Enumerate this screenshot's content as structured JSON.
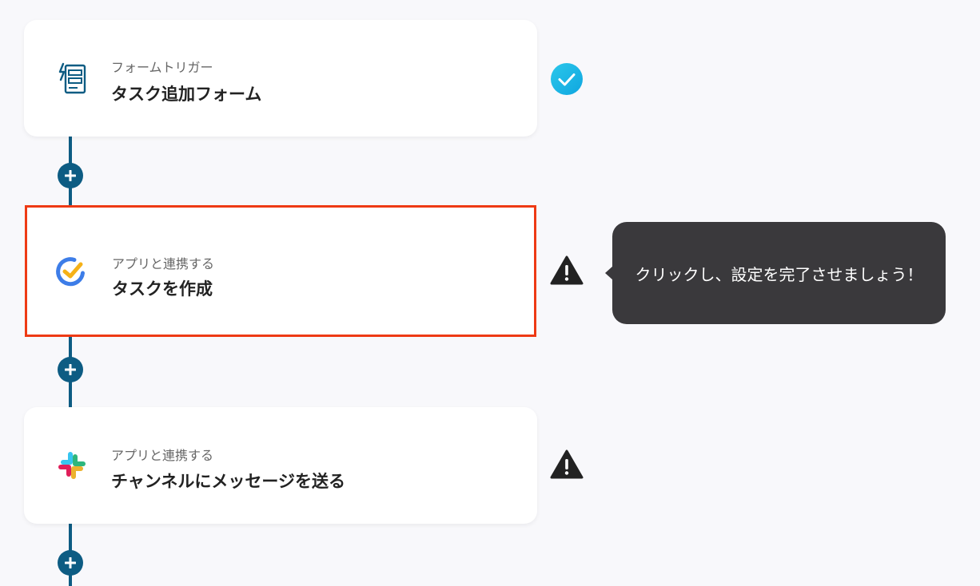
{
  "flow": {
    "steps": [
      {
        "category": "フォームトリガー",
        "title": "タスク追加フォーム",
        "icon": "form-icon",
        "status": "complete"
      },
      {
        "category": "アプリと連携する",
        "title": "タスクを作成",
        "icon": "task-app-icon",
        "status": "warning"
      },
      {
        "category": "アプリと連携する",
        "title": "チャンネルにメッセージを送る",
        "icon": "slack-icon",
        "status": "warning"
      }
    ],
    "tooltip": "クリックし、設定を完了させましょう！"
  },
  "colors": {
    "accent_line": "#0d5c83",
    "selected_border": "#ee3a14",
    "complete_badge": "#17b6e6",
    "warning_icon": "#222222",
    "tooltip_bg": "#3a393c"
  }
}
